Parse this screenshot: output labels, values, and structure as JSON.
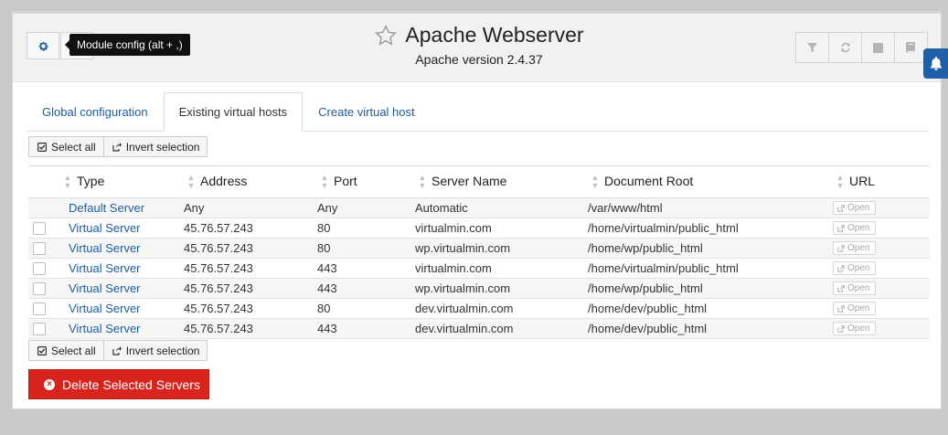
{
  "header": {
    "title": "Apache Webserver",
    "subtitle": "Apache version 2.4.37",
    "tooltip": "Module config (alt + ,)"
  },
  "tabs": [
    {
      "label": "Global configuration"
    },
    {
      "label": "Existing virtual hosts"
    },
    {
      "label": "Create virtual host"
    }
  ],
  "selection": {
    "select_all": "Select all",
    "invert": "Invert selection"
  },
  "table": {
    "columns": [
      "Type",
      "Address",
      "Port",
      "Server Name",
      "Document Root",
      "URL"
    ],
    "open_label": "Open",
    "rows": [
      {
        "type": "Default Server",
        "address": "Any",
        "port": "Any",
        "server": "Automatic",
        "root": "/var/www/html"
      },
      {
        "type": "Virtual Server",
        "address": "45.76.57.243",
        "port": "80",
        "server": "virtualmin.com",
        "root": "/home/virtualmin/public_html"
      },
      {
        "type": "Virtual Server",
        "address": "45.76.57.243",
        "port": "80",
        "server": "wp.virtualmin.com",
        "root": "/home/wp/public_html"
      },
      {
        "type": "Virtual Server",
        "address": "45.76.57.243",
        "port": "443",
        "server": "virtualmin.com",
        "root": "/home/virtualmin/public_html"
      },
      {
        "type": "Virtual Server",
        "address": "45.76.57.243",
        "port": "443",
        "server": "wp.virtualmin.com",
        "root": "/home/wp/public_html"
      },
      {
        "type": "Virtual Server",
        "address": "45.76.57.243",
        "port": "80",
        "server": "dev.virtualmin.com",
        "root": "/home/dev/public_html"
      },
      {
        "type": "Virtual Server",
        "address": "45.76.57.243",
        "port": "443",
        "server": "dev.virtualmin.com",
        "root": "/home/dev/public_html"
      }
    ]
  },
  "actions": {
    "delete_label": "Delete Selected Servers"
  },
  "colors": {
    "link": "#1c5d9c",
    "danger": "#d9231d",
    "notification": "#1f5fa8"
  },
  "icons": [
    "gear-icon",
    "star-icon",
    "filter-icon",
    "refresh-icon",
    "stop-icon",
    "book-icon",
    "bell-icon",
    "check-square-icon",
    "share-icon",
    "external-link-icon",
    "times-circle-icon"
  ]
}
